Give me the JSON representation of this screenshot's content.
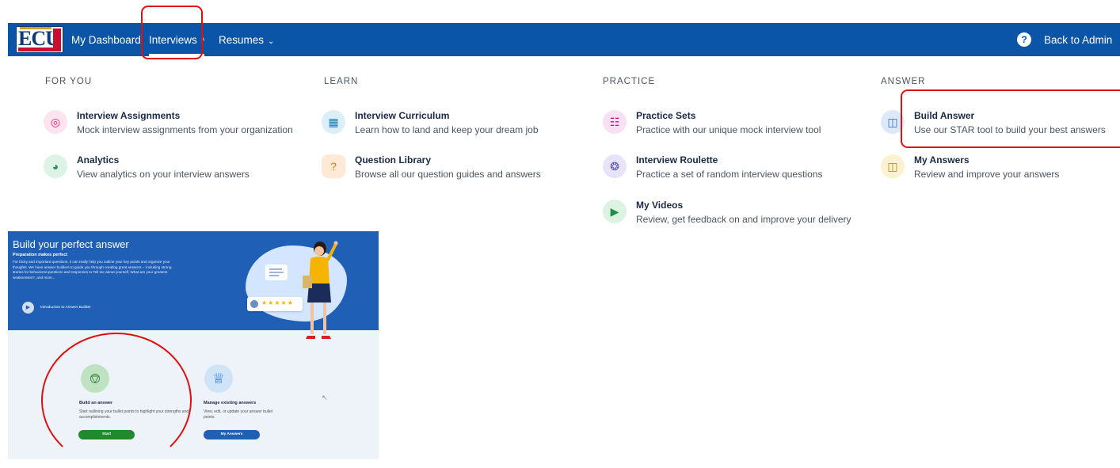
{
  "nav": {
    "logo_text": "ECU",
    "items": [
      {
        "label": "My Dashboard"
      },
      {
        "label": "Interviews",
        "chevron": "^"
      },
      {
        "label": "Resumes",
        "chevron": "v"
      }
    ],
    "help_glyph": "?",
    "back_label": "Back to Admin"
  },
  "menu": {
    "columns": [
      {
        "heading": "FOR YOU",
        "items": [
          {
            "title": "Interview Assignments",
            "desc": "Mock interview assignments from your organization",
            "icon": "target-icon",
            "color": "#e0237a"
          },
          {
            "title": "Analytics",
            "desc": "View analytics on your interview answers",
            "icon": "gauge-icon",
            "color": "#2f8f5a"
          }
        ]
      },
      {
        "heading": "LEARN",
        "items": [
          {
            "title": "Interview Curriculum",
            "desc": "Learn how to land and keep your dream job",
            "icon": "books-icon",
            "color": "#1f7fb8"
          },
          {
            "title": "Question Library",
            "desc": "Browse all our question guides and answers",
            "icon": "question-card-icon",
            "color": "#e07a10"
          }
        ]
      },
      {
        "heading": "PRACTICE",
        "items": [
          {
            "title": "Practice Sets",
            "desc": "Practice with our unique mock interview tool",
            "icon": "practice-icon",
            "color": "#c0188a"
          },
          {
            "title": "Interview Roulette",
            "desc": "Practice a set of random interview questions",
            "icon": "roulette-icon",
            "color": "#5a4fc4"
          },
          {
            "title": "My Videos",
            "desc": "Review, get feedback on and improve your delivery",
            "icon": "video-icon",
            "color": "#1f8f4a"
          }
        ]
      },
      {
        "heading": "ANSWER",
        "items": [
          {
            "title": "Build Answer",
            "desc": "Use our STAR tool to build your best answers",
            "icon": "build-icon",
            "color": "#1f6fd0"
          },
          {
            "title": "My Answers",
            "desc": "Review and improve your answers",
            "icon": "notebook-icon",
            "color": "#b08a00"
          }
        ]
      }
    ]
  },
  "builder": {
    "title": "Build your perfect answer",
    "subtitle": "Preparation makes perfect",
    "body": "For tricky and important questions, it can really help you outline your key points and organize your thoughts. We have answer builders to guide you through creating great answers -- including strong stories for behavioral questions and responses to Tell me about yourself, What are your greatest weaknesses?, and more...",
    "intro_label": "Introduction to Answer Builder",
    "stars": "★★★★★",
    "cards": [
      {
        "title": "Build an answer",
        "desc": "Start outlining your bullet points to highlight your strengths and accomplishments.",
        "button": "Start",
        "button_color": "#1f8a2e"
      },
      {
        "title": "Manage existing answers",
        "desc": "View, edit, or update your answer bullet points.",
        "button": "My Answers",
        "button_color": "#1f5fb5"
      }
    ]
  }
}
